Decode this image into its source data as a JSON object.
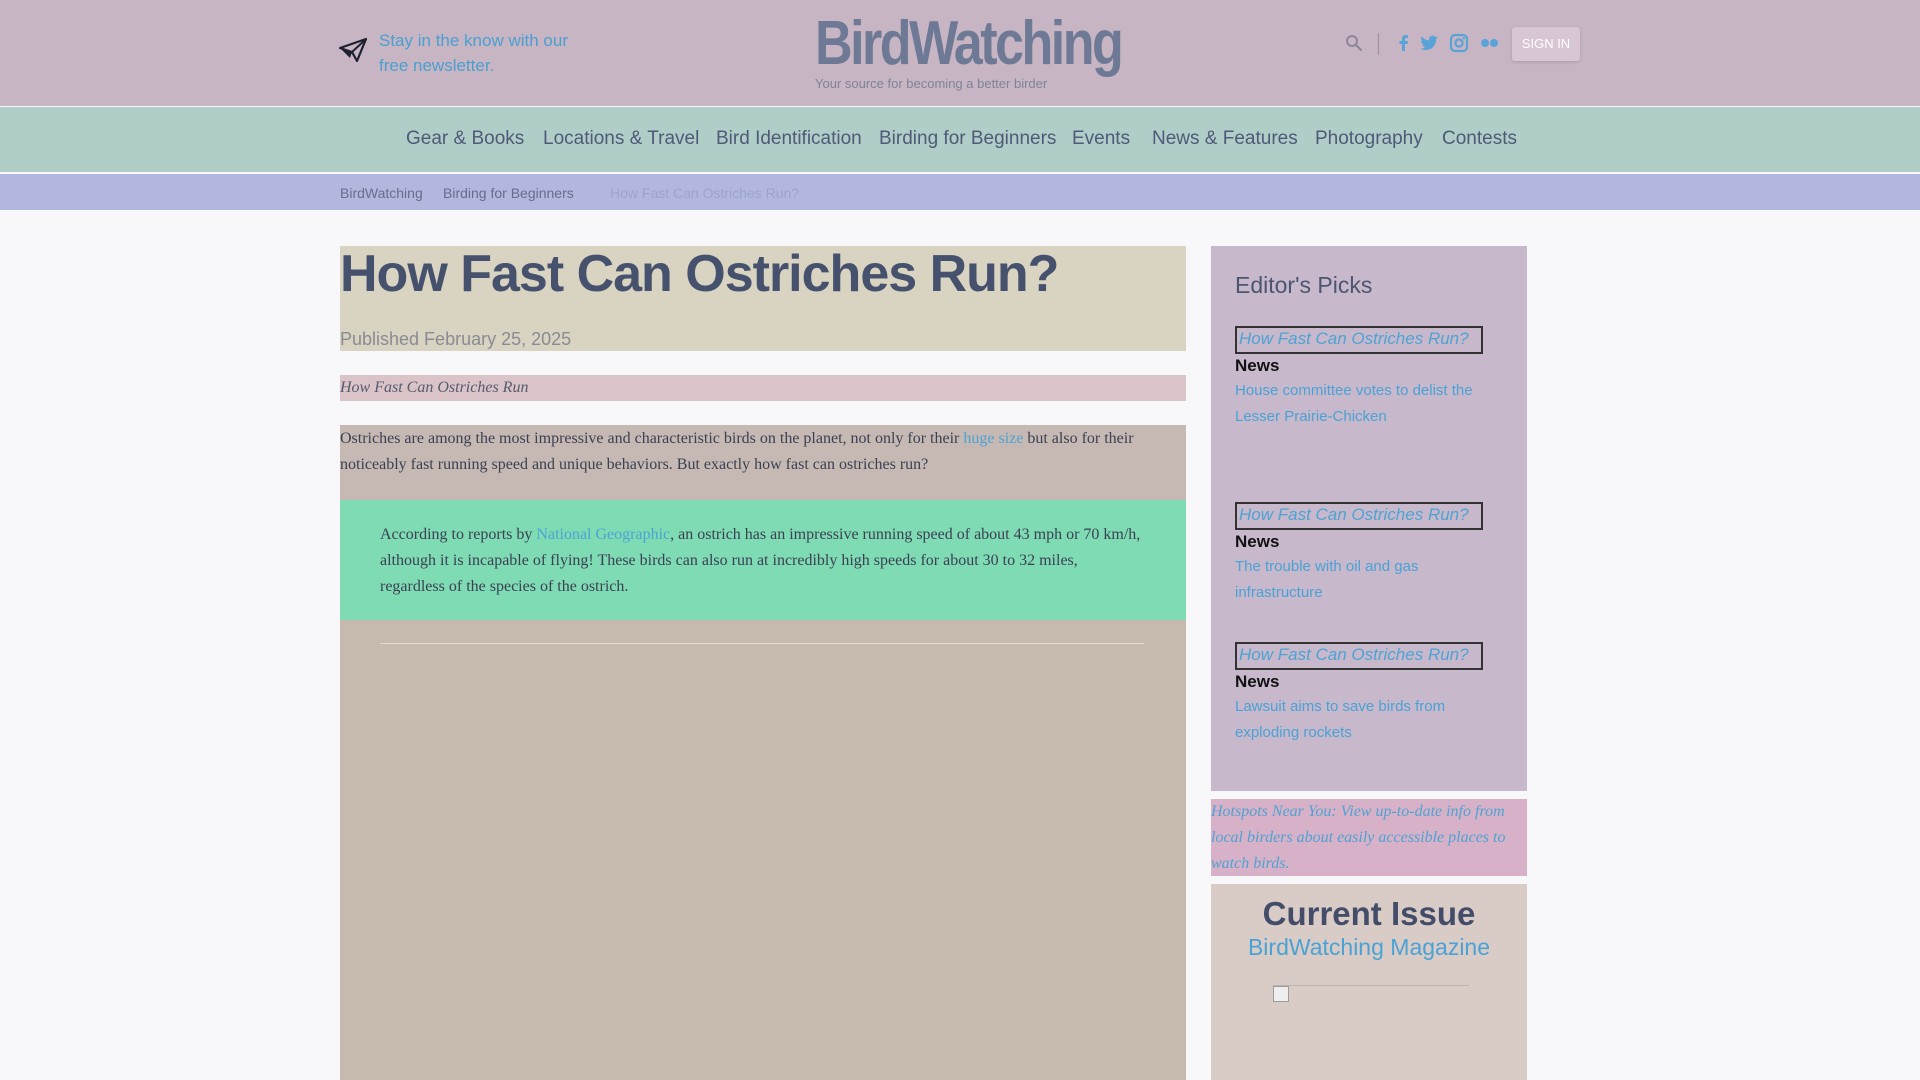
{
  "header": {
    "newsletter_text": "Stay in the know with our free newsletter.",
    "logo_title": "BirdWatching",
    "logo_tagline": "Your source for becoming a better birder",
    "signin_label": "SIGN IN",
    "social_icons": [
      "facebook-icon",
      "twitter-icon",
      "instagram-icon",
      "flickr-icon"
    ]
  },
  "nav": {
    "items": [
      "Gear & Books",
      "Locations & Travel",
      "Bird Identification",
      "Birding for Beginners",
      "Events",
      "News & Features",
      "Photography",
      "Contests"
    ]
  },
  "breadcrumb": {
    "items": [
      "BirdWatching",
      "Birding for Beginners",
      "How Fast Can Ostriches Run?"
    ]
  },
  "article": {
    "title": "How Fast Can Ostriches Run?",
    "published": "Published February 25, 2025",
    "hero_alt": "How Fast Can Ostriches Run",
    "intro_before": "Ostriches are among the most impressive and characteristic birds on the planet, not only for their ",
    "intro_link": "huge size",
    "intro_after": " but also for their noticeably fast running speed and unique behaviors. But exactly how fast can ostriches run?",
    "quote_before": "According to reports by ",
    "quote_link": "National Geographic",
    "quote_after": ", an ostrich has an impressive running speed of about 43 mph or 70 km/h, although it is incapable of flying! These birds can also run at incredibly high speeds for about 30 to 32 miles, regardless of the species of the ostrich."
  },
  "sidebar": {
    "editors_picks_title": "Editor's Picks",
    "picks": [
      {
        "image_alt": "How Fast Can Ostriches Run?",
        "category": "News",
        "headline": "House committee votes to delist the Lesser Prairie-Chicken"
      },
      {
        "image_alt": "How Fast Can Ostriches Run?",
        "category": "News",
        "headline": "The trouble with oil and gas infrastructure"
      },
      {
        "image_alt": "How Fast Can Ostriches Run?",
        "category": "News",
        "headline": "Lawsuit aims to save birds from exploding rockets"
      }
    ],
    "hotspots_alt": "Hotspots Near You: View up-to-date info from local birders about easily accessible places to watch birds.",
    "current_issue_title": "Current Issue",
    "current_issue_subtitle": "BirdWatching Magazine"
  },
  "colors": {
    "header_bg": "#c7b5c3",
    "nav_bg": "#b0cec7",
    "breadcrumb_bg": "#b2b8dd",
    "link": "#4ea3d4",
    "quote_bg": "#7edbb4"
  }
}
